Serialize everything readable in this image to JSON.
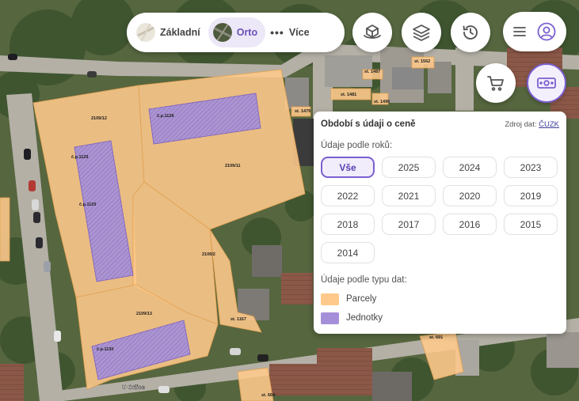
{
  "map_labels": {
    "parcel_2109_12": "2109/12",
    "parcel_2109_11": "2109/11",
    "parcel_2109_2": "2109/2",
    "parcel_2109_13": "2109/13",
    "cp_1128": "č.p.1128",
    "cp_1129": "č.p.1129",
    "cp_1130": "č.p.1130",
    "st_1167": "st. 1167",
    "st_1562": "st. 1562",
    "st_1487": "st. 1487",
    "st_1481": "st. 1481",
    "st_1496": "st. 1496",
    "st_1479": "st. 1479",
    "st_691": "st. 691",
    "st_664": "st. 664",
    "street": "U Orlice"
  },
  "basemap": {
    "zakladni_label": "Základní",
    "orto_label": "Orto",
    "more_label": "Více",
    "more_dots": "•••",
    "active": "Orto"
  },
  "panel": {
    "title": "Období s údaji o ceně",
    "source_prefix": "Zdroj dat:",
    "source_link": "ČUZK",
    "years_label": "Údaje podle roků:",
    "years": [
      "Vše",
      "2025",
      "2024",
      "2023",
      "2022",
      "2021",
      "2020",
      "2019",
      "2018",
      "2017",
      "2016",
      "2015",
      "2014"
    ],
    "selected_year": "Vše",
    "types_label": "Údaje podle typu dat:",
    "types": [
      {
        "label": "Parcely",
        "color": "#ffc98c"
      },
      {
        "label": "Jednotky",
        "color": "#a58fd9"
      }
    ]
  },
  "colors": {
    "accent": "#7b5fd0",
    "parcel_fill": "#ffc98c",
    "unit_fill": "#a58fd9"
  }
}
